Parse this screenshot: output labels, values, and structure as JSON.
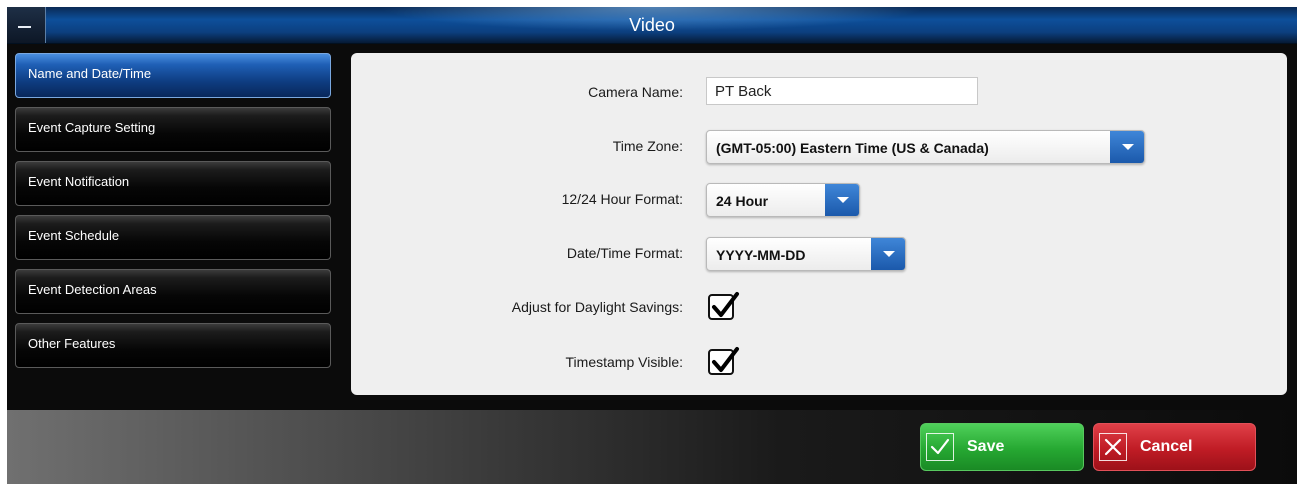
{
  "window": {
    "title": "Video"
  },
  "sidebar": {
    "items": [
      {
        "label": "Name and Date/Time",
        "active": true
      },
      {
        "label": "Event Capture Setting",
        "active": false
      },
      {
        "label": "Event Notification",
        "active": false
      },
      {
        "label": "Event Schedule",
        "active": false
      },
      {
        "label": "Event Detection Areas",
        "active": false
      },
      {
        "label": "Other Features",
        "active": false
      }
    ]
  },
  "form": {
    "camera_name": {
      "label": "Camera Name:",
      "value": "PT Back"
    },
    "time_zone": {
      "label": "Time Zone:",
      "value": "(GMT-05:00) Eastern Time (US & Canada)"
    },
    "hour_format": {
      "label": "12/24 Hour Format:",
      "value": "24 Hour"
    },
    "date_format": {
      "label": "Date/Time Format:",
      "value": "YYYY-MM-DD"
    },
    "daylight_savings": {
      "label": "Adjust for Daylight Savings:",
      "checked": true
    },
    "timestamp_visible": {
      "label": "Timestamp Visible:",
      "checked": true
    }
  },
  "footer": {
    "save_label": "Save",
    "cancel_label": "Cancel"
  },
  "colors": {
    "accent_blue": "#1b59ab",
    "save_green": "#26a832",
    "cancel_red": "#c01c25"
  },
  "icons": {
    "collapse": "minus-icon",
    "dropdown": "chevron-down-icon",
    "check": "checkmark-icon",
    "save": "check-icon",
    "cancel": "close-icon"
  }
}
